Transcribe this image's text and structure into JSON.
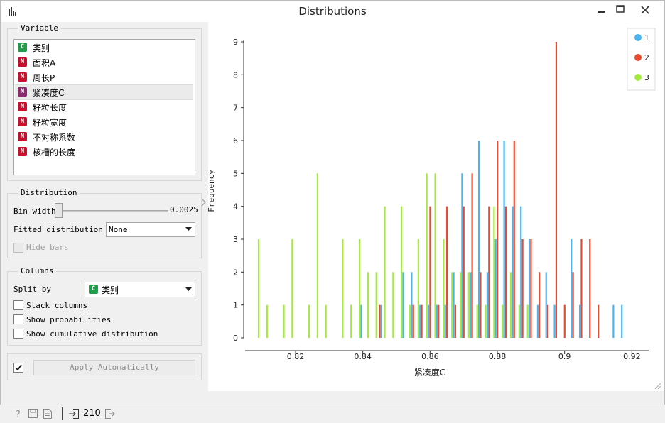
{
  "window": {
    "title": "Distributions"
  },
  "variable_group": {
    "title": "Variable",
    "items": [
      {
        "type": "C",
        "label": "类别",
        "color": "#1f9e49"
      },
      {
        "type": "N",
        "label": "面积A",
        "color": "#c8102e"
      },
      {
        "type": "N",
        "label": "周长P",
        "color": "#c8102e"
      },
      {
        "type": "N",
        "label": "紧凑度C",
        "color": "#8b2a6e",
        "selected": true
      },
      {
        "type": "N",
        "label": "籽粒长度",
        "color": "#c8102e"
      },
      {
        "type": "N",
        "label": "籽粒宽度",
        "color": "#c8102e"
      },
      {
        "type": "N",
        "label": "不对称系数",
        "color": "#c8102e"
      },
      {
        "type": "N",
        "label": "核槽的长度",
        "color": "#c8102e"
      }
    ]
  },
  "distribution_group": {
    "title": "Distribution",
    "bin_width_label": "Bin width",
    "bin_width_value": "0.0025",
    "bin_slider_fraction": 0.0,
    "fitted_label": "Fitted distribution",
    "fitted_value": "None",
    "hide_bars_label": "Hide bars",
    "hide_bars_checked": false
  },
  "columns_group": {
    "title": "Columns",
    "split_by_label": "Split by",
    "split_by_badge": "C",
    "split_by_value": "类别",
    "stack_label": "Stack columns",
    "prob_label": "Show probabilities",
    "cumul_label": "Show cumulative distribution"
  },
  "apply": {
    "checked": true,
    "label": "Apply Automatically"
  },
  "status": {
    "count": "210"
  },
  "chart_data": {
    "type": "bar",
    "xlabel": "紧凑度C",
    "ylabel": "Frequency",
    "xlim": [
      0.805,
      0.925
    ],
    "ylim": [
      0,
      9
    ],
    "xticks": [
      "0.82",
      "0.84",
      "0.86",
      "0.88",
      "0.9",
      "0.92"
    ],
    "yticks": [
      "0",
      "1",
      "2",
      "3",
      "4",
      "5",
      "6",
      "7",
      "8",
      "9"
    ],
    "legend_position": "top-right",
    "series": [
      {
        "name": "1",
        "color": "#49b4ef",
        "x": [
          0.8395,
          0.8455,
          0.852,
          0.8545,
          0.857,
          0.8595,
          0.862,
          0.8645,
          0.867,
          0.8695,
          0.872,
          0.8745,
          0.877,
          0.8795,
          0.882,
          0.8845,
          0.887,
          0.8895,
          0.892,
          0.8945,
          0.897,
          0.902,
          0.9045,
          0.9145,
          0.917
        ],
        "values": [
          1,
          1,
          2,
          2,
          1,
          1,
          1,
          1,
          2,
          5,
          2,
          6,
          2,
          3,
          6,
          4,
          4,
          3,
          1,
          2,
          1,
          3,
          1,
          1,
          1
        ]
      },
      {
        "name": "2",
        "color": "#e84c30",
        "x": [
          0.845,
          0.855,
          0.8575,
          0.86,
          0.8625,
          0.865,
          0.8675,
          0.87,
          0.8725,
          0.875,
          0.8775,
          0.88,
          0.8825,
          0.885,
          0.8875,
          0.89,
          0.8925,
          0.895,
          0.8975,
          0.9,
          0.9025,
          0.905,
          0.9075,
          0.91
        ],
        "values": [
          1,
          1,
          1,
          4,
          1,
          4,
          1,
          4,
          5,
          2,
          4,
          6,
          4,
          6,
          3,
          3,
          2,
          1,
          9,
          1,
          2,
          3,
          3,
          1
        ]
      },
      {
        "name": "3",
        "color": "#a5ea3e",
        "x": [
          0.809,
          0.8115,
          0.8165,
          0.819,
          0.824,
          0.8265,
          0.829,
          0.834,
          0.8365,
          0.839,
          0.8415,
          0.844,
          0.8465,
          0.849,
          0.8515,
          0.854,
          0.8565,
          0.859,
          0.8615,
          0.864,
          0.8665,
          0.869,
          0.8715,
          0.874,
          0.8765,
          0.879,
          0.8815,
          0.884,
          0.8865,
          0.889
        ],
        "values": [
          3,
          1,
          1,
          3,
          1,
          5,
          1,
          3,
          1,
          3,
          2,
          2,
          4,
          2,
          4,
          1,
          3,
          5,
          5,
          3,
          2,
          2,
          2,
          1,
          1,
          4,
          1,
          2,
          1,
          1
        ]
      }
    ]
  }
}
